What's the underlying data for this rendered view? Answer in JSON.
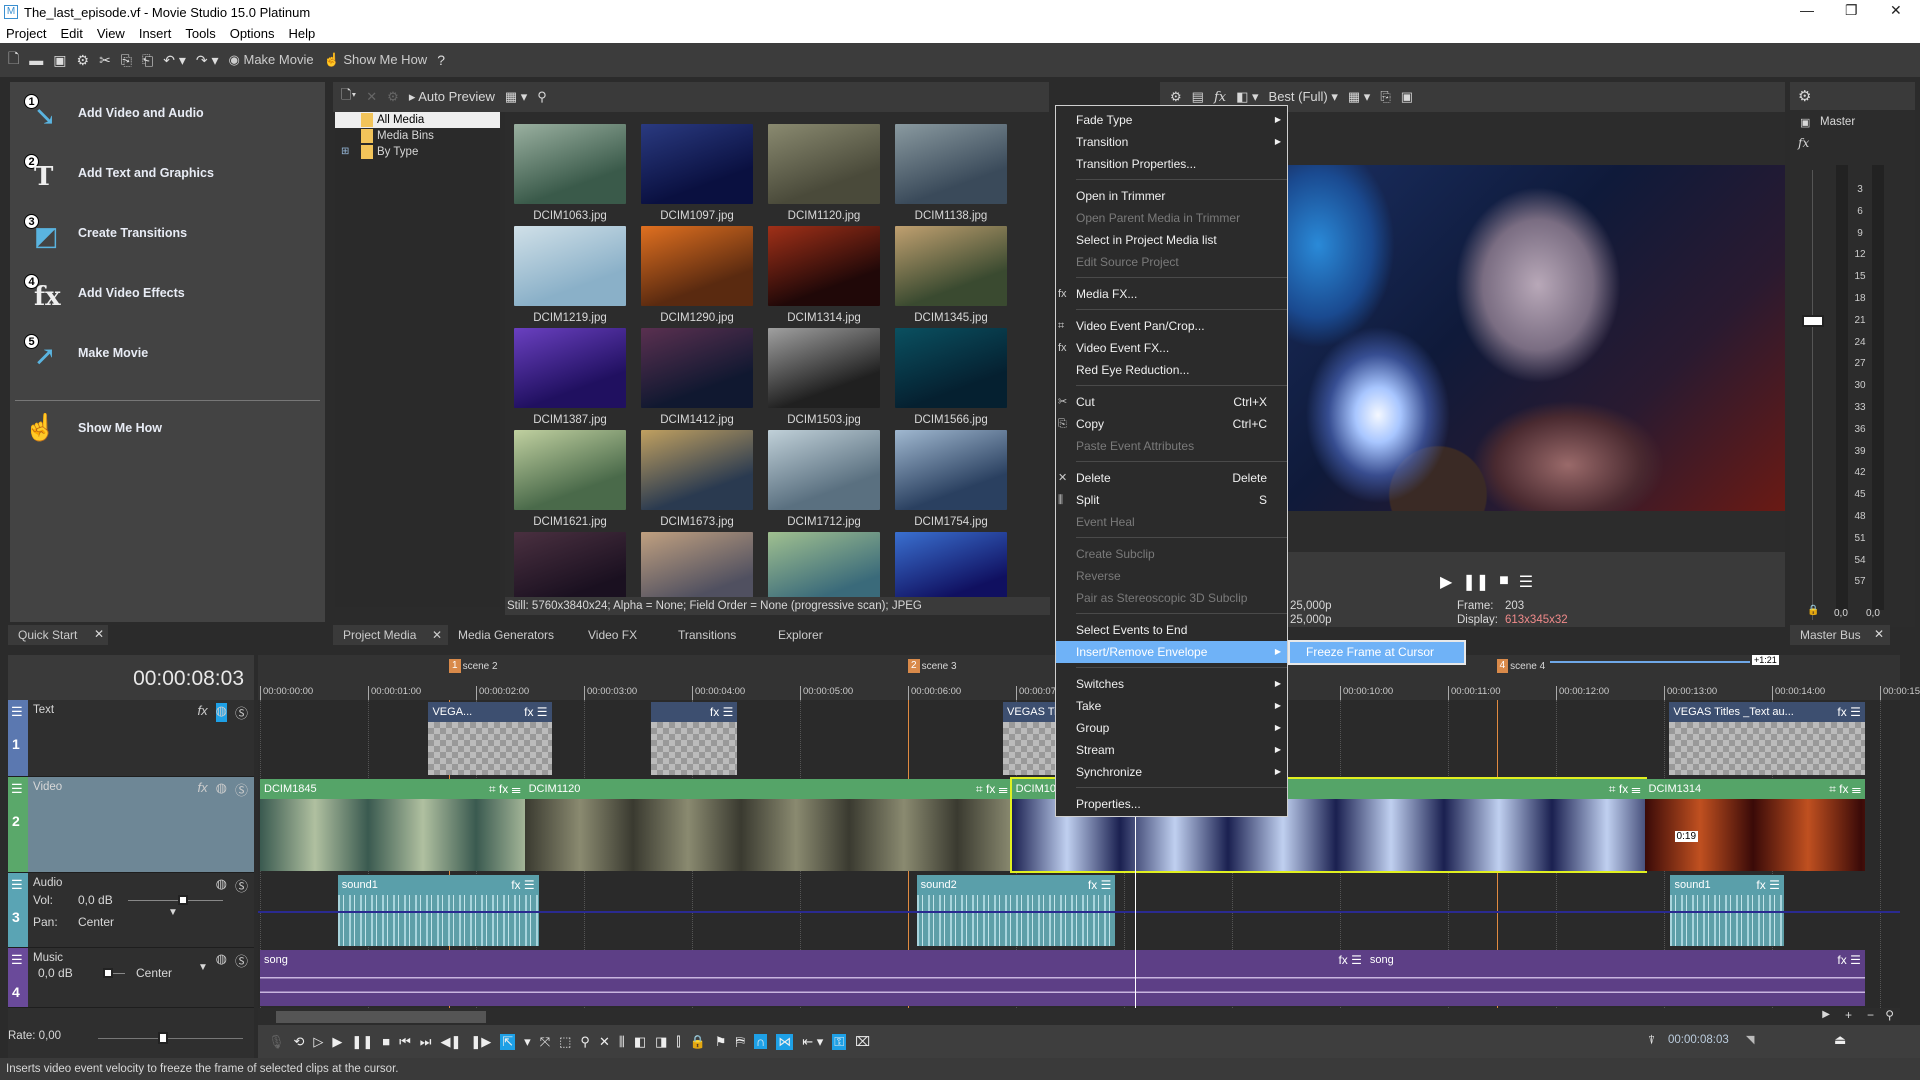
{
  "window": {
    "title": "The_last_episode.vf - Movie Studio 15.0 Platinum",
    "app_icon": "M"
  },
  "menubar": [
    "Project",
    "Edit",
    "View",
    "Insert",
    "Tools",
    "Options",
    "Help"
  ],
  "toolbar": {
    "make_movie": "Make Movie",
    "show_me_how": "Show Me How"
  },
  "quickstart": {
    "items": [
      {
        "num": "1",
        "label": "Add Video and Audio",
        "glyph": "↘"
      },
      {
        "num": "2",
        "label": "Add Text and Graphics",
        "glyph": "T"
      },
      {
        "num": "3",
        "label": "Create Transitions",
        "glyph": "◩"
      },
      {
        "num": "4",
        "label": "Add Video Effects",
        "glyph": "fx"
      },
      {
        "num": "5",
        "label": "Make Movie",
        "glyph": "↗"
      }
    ],
    "show_me_how": "Show Me How"
  },
  "tabs_left": {
    "quick_start": "Quick Start"
  },
  "tabs_media": [
    "Project Media",
    "Media Generators",
    "Video FX",
    "Transitions",
    "Explorer"
  ],
  "media": {
    "auto_preview": "Auto Preview",
    "tree": [
      "All Media",
      "Media Bins",
      "By Type"
    ],
    "files": [
      {
        "name": "DCIM1063.jpg",
        "c": [
          "#3a5a4a",
          "#9ab0a0"
        ]
      },
      {
        "name": "DCIM1097.jpg",
        "c": [
          "#0a1040",
          "#2a3a80"
        ]
      },
      {
        "name": "DCIM1120.jpg",
        "c": [
          "#4a4a3a",
          "#8a8a70"
        ]
      },
      {
        "name": "DCIM1138.jpg",
        "c": [
          "#3a4a5a",
          "#8a9aa0"
        ]
      },
      {
        "name": "DCIM1219.jpg",
        "c": [
          "#8ab0c8",
          "#d0e0e8"
        ]
      },
      {
        "name": "DCIM1290.jpg",
        "c": [
          "#5a2a10",
          "#e07020"
        ]
      },
      {
        "name": "DCIM1314.jpg",
        "c": [
          "#200808",
          "#a03018"
        ]
      },
      {
        "name": "DCIM1345.jpg",
        "c": [
          "#3a4a30",
          "#c0a070"
        ]
      },
      {
        "name": "DCIM1387.jpg",
        "c": [
          "#201060",
          "#6a40c0"
        ]
      },
      {
        "name": "DCIM1412.jpg",
        "c": [
          "#101830",
          "#5a3050"
        ]
      },
      {
        "name": "DCIM1503.jpg",
        "c": [
          "#202020",
          "#a0a0a0"
        ]
      },
      {
        "name": "DCIM1566.jpg",
        "c": [
          "#052030",
          "#0a5060"
        ]
      },
      {
        "name": "DCIM1621.jpg",
        "c": [
          "#4a6a4a",
          "#c0d0a0"
        ]
      },
      {
        "name": "DCIM1673.jpg",
        "c": [
          "#2a3a50",
          "#c0a060"
        ]
      },
      {
        "name": "DCIM1712.jpg",
        "c": [
          "#5a7080",
          "#c0d0d8"
        ]
      },
      {
        "name": "DCIM1754.jpg",
        "c": [
          "#2a4060",
          "#a0b8d0"
        ]
      },
      {
        "name": "",
        "c": [
          "#1a1020",
          "#4a3040"
        ]
      },
      {
        "name": "",
        "c": [
          "#505060",
          "#c0a080"
        ]
      },
      {
        "name": "",
        "c": [
          "#3a6a7a",
          "#a0c090"
        ]
      },
      {
        "name": "",
        "c": [
          "#101060",
          "#3a70d0"
        ]
      }
    ],
    "info": "Still: 5760x3840x24; Alpha = None; Field Order = None (progressive scan); JPEG"
  },
  "preview": {
    "quality": "Best (Full)",
    "project_rate": "25,000p",
    "preview_rate": "25,000p",
    "frame_label": "Frame:",
    "frame": "203",
    "display_label": "Display:",
    "display": "613x345x32"
  },
  "master": {
    "label": "Master",
    "tab": "Master Bus",
    "scale": [
      "3",
      "6",
      "9",
      "12",
      "15",
      "18",
      "21",
      "24",
      "27",
      "30",
      "33",
      "36",
      "39",
      "42",
      "45",
      "48",
      "51",
      "54",
      "57"
    ],
    "peak_l": "0,0",
    "peak_r": "0,0"
  },
  "timeline": {
    "time": "00:00:08:03",
    "cursor_sec": 8.1,
    "ruler": [
      "00:00:00:00",
      "00:00:01:00",
      "00:00:02:00",
      "00:00:03:00",
      "00:00:04:00",
      "00:00:05:00",
      "00:00:06:00",
      "00:00:07:00",
      "00:00:08:00",
      "00:00:09:00",
      "00:00:10:00",
      "00:00:11:00",
      "00:00:12:00",
      "00:00:13:00",
      "00:00:14:00",
      "00:00:15:00"
    ],
    "markers": [
      {
        "num": "1",
        "label": "scene 2",
        "t": 1.75
      },
      {
        "num": "2",
        "label": "scene 3",
        "t": 6.0
      },
      {
        "num": "4",
        "label": "scene 4",
        "t": 11.45
      }
    ],
    "loop_label": "+1:21",
    "tracks": [
      {
        "num": "1",
        "name": "Text",
        "color": "#5b78b0",
        "bg": "#2a2a2a"
      },
      {
        "num": "2",
        "name": "Video",
        "color": "#5aa86a",
        "bg": "#6e8796"
      },
      {
        "num": "3",
        "name": "Audio",
        "color": "#5aa4b4",
        "bg": "#2a2a2a",
        "vol_label": "Vol:",
        "vol": "0,0 dB",
        "pan_label": "Pan:",
        "pan": "Center"
      },
      {
        "num": "4",
        "name": "Music",
        "color": "#6a4a9a",
        "bg": "#2a2a2a",
        "vol": "0,0 dB",
        "pan": "Center"
      }
    ],
    "clips": {
      "text": [
        {
          "name": "VEGA...",
          "s": 1.56,
          "e": 2.7
        },
        {
          "name": "",
          "s": 3.62,
          "e": 4.42
        },
        {
          "name": "VEGAS Titles",
          "s": 6.88,
          "e": 7.7
        },
        {
          "name": "VEGAS Titles _Text au...",
          "s": 13.05,
          "e": 14.86
        }
      ],
      "video": [
        {
          "name": "DCIM1845",
          "s": 0,
          "e": 2.45,
          "c": [
            "#3a5a50",
            "#b0c0a0"
          ]
        },
        {
          "name": "DCIM1120",
          "s": 2.45,
          "e": 6.96,
          "c": [
            "#3a3a30",
            "#8a8a70"
          ]
        },
        {
          "name": "DCIM10...",
          "s": 6.96,
          "e": 12.82,
          "c": [
            "#1a2050",
            "#c0d0f0"
          ],
          "selected": true
        },
        {
          "name": "DCIM1314",
          "s": 12.82,
          "e": 14.86,
          "c": [
            "#3a0a08",
            "#c05020"
          ],
          "label": "0:19"
        }
      ],
      "audio": [
        {
          "name": "sound1",
          "s": 0.72,
          "e": 2.58
        },
        {
          "name": "sound2",
          "s": 6.08,
          "e": 7.92
        },
        {
          "name": "sound1",
          "s": 13.06,
          "e": 14.11
        }
      ],
      "music": [
        {
          "name": "song",
          "s": 0,
          "e": 10.24
        },
        {
          "name": "song",
          "s": 10.24,
          "e": 14.86
        }
      ]
    },
    "rate": "Rate: 0,00",
    "end_time": "00:00:08:03"
  },
  "context_menu": [
    {
      "label": "Fade Type",
      "sub": true
    },
    {
      "label": "Transition",
      "sub": true
    },
    {
      "label": "Transition Properties..."
    },
    {
      "sep": true
    },
    {
      "label": "Open in Trimmer"
    },
    {
      "label": "Open Parent Media in Trimmer",
      "disabled": true
    },
    {
      "label": "Select in Project Media list"
    },
    {
      "label": "Edit Source Project",
      "disabled": true
    },
    {
      "sep": true
    },
    {
      "label": "Media FX...",
      "icon": "fx"
    },
    {
      "sep": true
    },
    {
      "label": "Video Event Pan/Crop...",
      "icon": "⌗"
    },
    {
      "label": "Video Event FX...",
      "icon": "fx"
    },
    {
      "label": "Red Eye Reduction..."
    },
    {
      "sep": true
    },
    {
      "label": "Cut",
      "shortcut": "Ctrl+X",
      "icon": "✂"
    },
    {
      "label": "Copy",
      "shortcut": "Ctrl+C",
      "icon": "⎘"
    },
    {
      "label": "Paste Event Attributes",
      "disabled": true
    },
    {
      "sep": true
    },
    {
      "label": "Delete",
      "shortcut": "Delete",
      "icon": "✕"
    },
    {
      "label": "Split",
      "shortcut": "S",
      "icon": "⫼"
    },
    {
      "label": "Event Heal",
      "disabled": true
    },
    {
      "sep": true
    },
    {
      "label": "Create Subclip",
      "disabled": true
    },
    {
      "label": "Reverse",
      "disabled": true
    },
    {
      "label": "Pair as Stereoscopic 3D Subclip",
      "disabled": true
    },
    {
      "sep": true
    },
    {
      "label": "Select Events to End"
    },
    {
      "label": "Insert/Remove Envelope",
      "sub": true,
      "active": true
    },
    {
      "sep": true
    },
    {
      "label": "Switches",
      "sub": true
    },
    {
      "label": "Take",
      "sub": true
    },
    {
      "label": "Group",
      "sub": true
    },
    {
      "label": "Stream",
      "sub": true
    },
    {
      "label": "Synchronize",
      "sub": true
    },
    {
      "sep": true
    },
    {
      "label": "Properties..."
    }
  ],
  "submenu": {
    "label": "Freeze Frame at Cursor"
  },
  "status": "Inserts video event velocity to freeze the frame of selected clips at the cursor."
}
